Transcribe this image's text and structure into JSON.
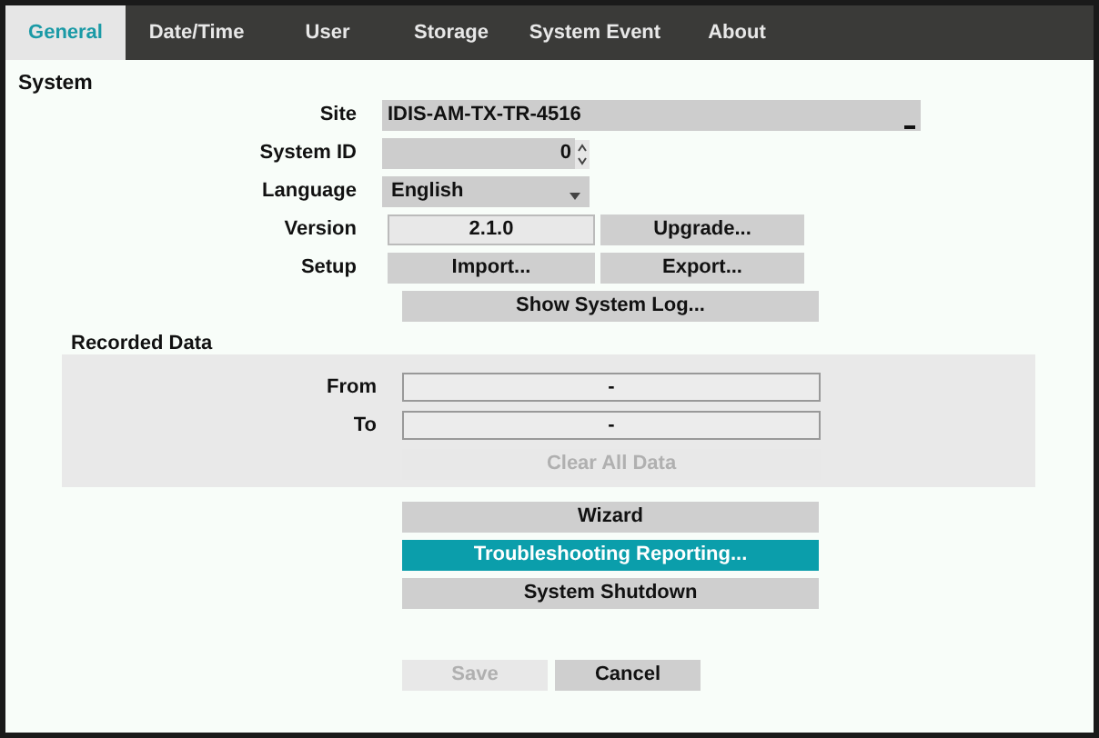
{
  "tabs": [
    {
      "label": "General",
      "selected": true
    },
    {
      "label": "Date/Time",
      "selected": false
    },
    {
      "label": "User",
      "selected": false
    },
    {
      "label": "Storage",
      "selected": false
    },
    {
      "label": "System Event",
      "selected": false
    },
    {
      "label": "About",
      "selected": false
    }
  ],
  "system": {
    "title": "System",
    "site": {
      "label": "Site",
      "value": "IDIS-AM-TX-TR-4516"
    },
    "system_id": {
      "label": "System ID",
      "value": "0"
    },
    "language": {
      "label": "Language",
      "value": "English"
    },
    "version": {
      "label": "Version",
      "value": "2.1.0",
      "button": "Upgrade..."
    },
    "setup": {
      "label": "Setup",
      "import": "Import...",
      "export": "Export..."
    },
    "log_button": "Show System Log..."
  },
  "recorded_data": {
    "title": "Recorded Data",
    "from": {
      "label": "From",
      "value": "-"
    },
    "to": {
      "label": "To",
      "value": "-"
    },
    "clear": {
      "label": "Clear All Data",
      "disabled": true
    }
  },
  "actions": [
    {
      "label": "Wizard",
      "focused": false
    },
    {
      "label": "Troubleshooting Reporting...",
      "focused": true
    },
    {
      "label": "System Shutdown",
      "focused": false
    }
  ],
  "footer": [
    {
      "label": "Save",
      "disabled": true
    },
    {
      "label": "Cancel",
      "disabled": false
    }
  ]
}
